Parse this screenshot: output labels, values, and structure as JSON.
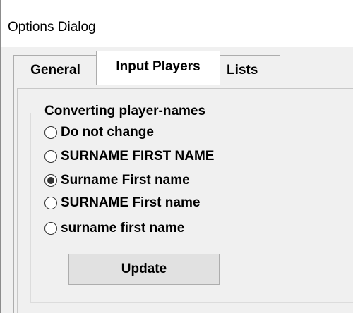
{
  "window": {
    "title": "Options Dialog"
  },
  "tabs": [
    {
      "label": "General",
      "selected": false
    },
    {
      "label": "Input Players",
      "selected": true
    },
    {
      "label": "Lists",
      "selected": false
    }
  ],
  "group": {
    "legend": "Converting player-names",
    "options": [
      {
        "label": "Do not change",
        "checked": false
      },
      {
        "label": "SURNAME FIRST NAME",
        "checked": false
      },
      {
        "label": "Surname First name",
        "checked": true
      },
      {
        "label": "SURNAME First name",
        "checked": false
      },
      {
        "label": "surname first name",
        "checked": false
      }
    ]
  },
  "buttons": {
    "update_label": "Update"
  }
}
